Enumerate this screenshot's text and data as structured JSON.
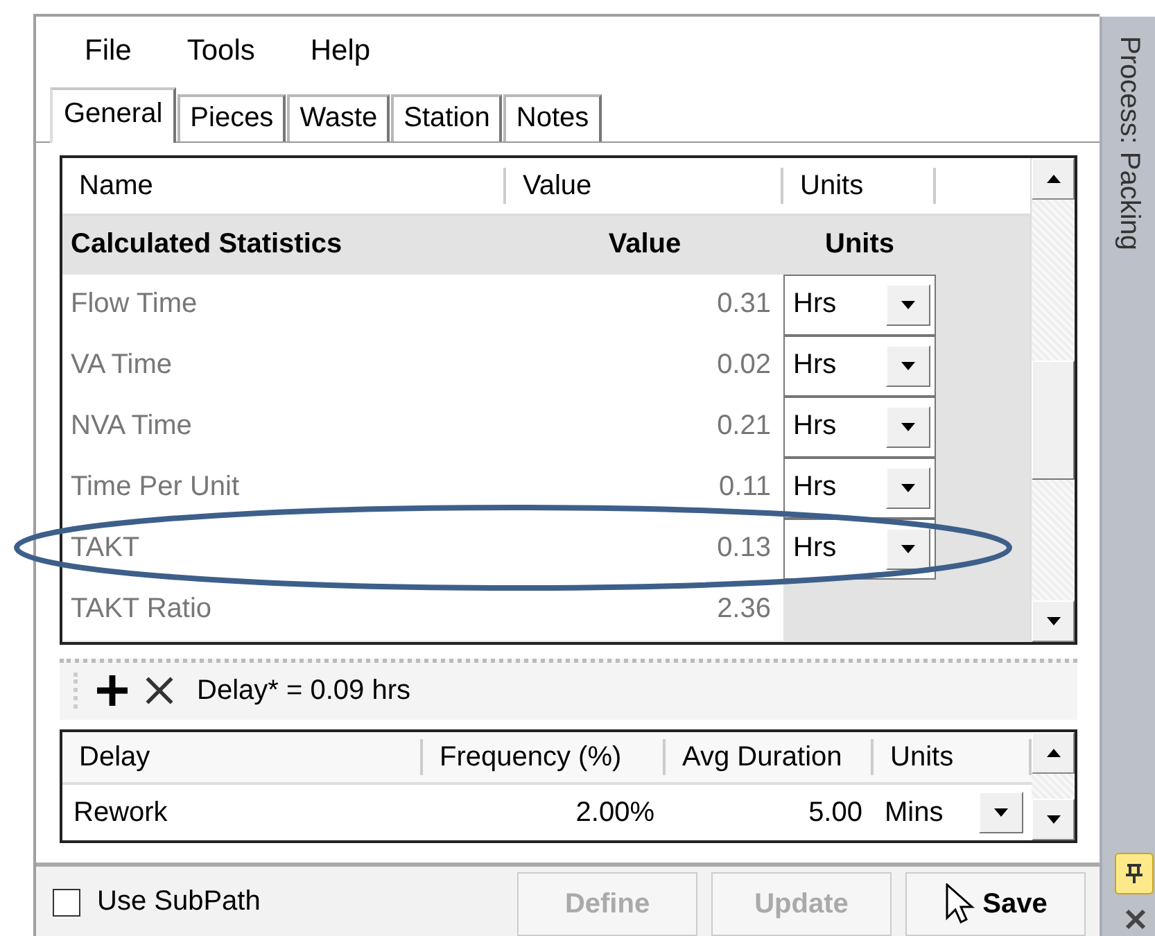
{
  "menu": [
    "File",
    "Tools",
    "Help"
  ],
  "tabs": [
    {
      "label": "General",
      "selected": true
    },
    {
      "label": "Pieces",
      "selected": false
    },
    {
      "label": "Waste",
      "selected": false
    },
    {
      "label": "Station",
      "selected": false
    },
    {
      "label": "Notes",
      "selected": false
    }
  ],
  "stats_table": {
    "columns": [
      "Name",
      "Value",
      "Units"
    ],
    "group": {
      "label": "Calculated Statistics",
      "value_heading": "Value",
      "units_heading": "Units"
    },
    "rows": [
      {
        "name": "Flow Time",
        "value": "0.31",
        "units": "Hrs"
      },
      {
        "name": "VA Time",
        "value": "0.02",
        "units": "Hrs"
      },
      {
        "name": "NVA Time",
        "value": "0.21",
        "units": "Hrs"
      },
      {
        "name": "Time Per Unit",
        "value": "0.11",
        "units": "Hrs"
      },
      {
        "name": "TAKT",
        "value": "0.13",
        "units": "Hrs"
      },
      {
        "name": "TAKT Ratio",
        "value": "2.36"
      }
    ]
  },
  "annotation": {
    "kind": "ellipse"
  },
  "delay_toolbar": {
    "summary": "Delay* = 0.09 hrs"
  },
  "delay_table": {
    "columns": [
      "Delay",
      "Frequency (%)",
      "Avg Duration",
      "Units"
    ],
    "rows": [
      {
        "delay": "Rework",
        "frequency": "2.00%",
        "avg_duration": "5.00",
        "units": "Mins"
      }
    ]
  },
  "footer": {
    "use_subpath": {
      "label": "Use SubPath",
      "checked": false
    },
    "buttons": [
      {
        "label": "Define",
        "disabled": true
      },
      {
        "label": "Update",
        "disabled": true
      },
      {
        "label": "Save",
        "disabled": false,
        "cursor": true
      }
    ]
  },
  "side_panel": {
    "title": "Process: Packing"
  }
}
